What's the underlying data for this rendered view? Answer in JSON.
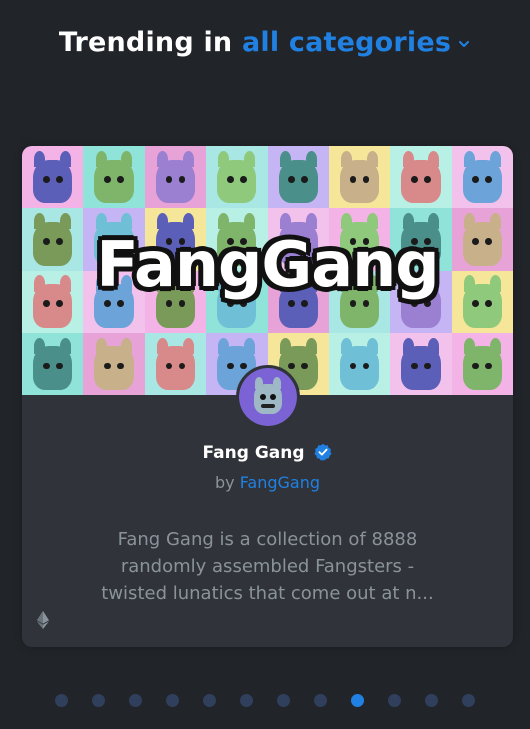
{
  "heading": {
    "prefix": "Trending in",
    "link": "all categories",
    "dropdown_icon": "chevron-down-icon",
    "accent_color": "#2081e2"
  },
  "card": {
    "banner_logo": "FangGang",
    "collection_name": "Fang Gang",
    "verified_icon": "verified-badge-icon",
    "by_label": "by",
    "creator": "FangGang",
    "description_lines": [
      "Fang Gang is a collection of 8888",
      "randomly assembled Fangsters -",
      "twisted lunatics that come out at n..."
    ],
    "chain_icon": "ethereum-icon"
  },
  "carousel": {
    "dot_count": 12,
    "active_index": 8
  },
  "colors": {
    "background": "#212429",
    "card": "#303339",
    "dot_inactive": "#303f5c",
    "dot_active": "#2081e2",
    "muted_text": "#8a939b"
  }
}
